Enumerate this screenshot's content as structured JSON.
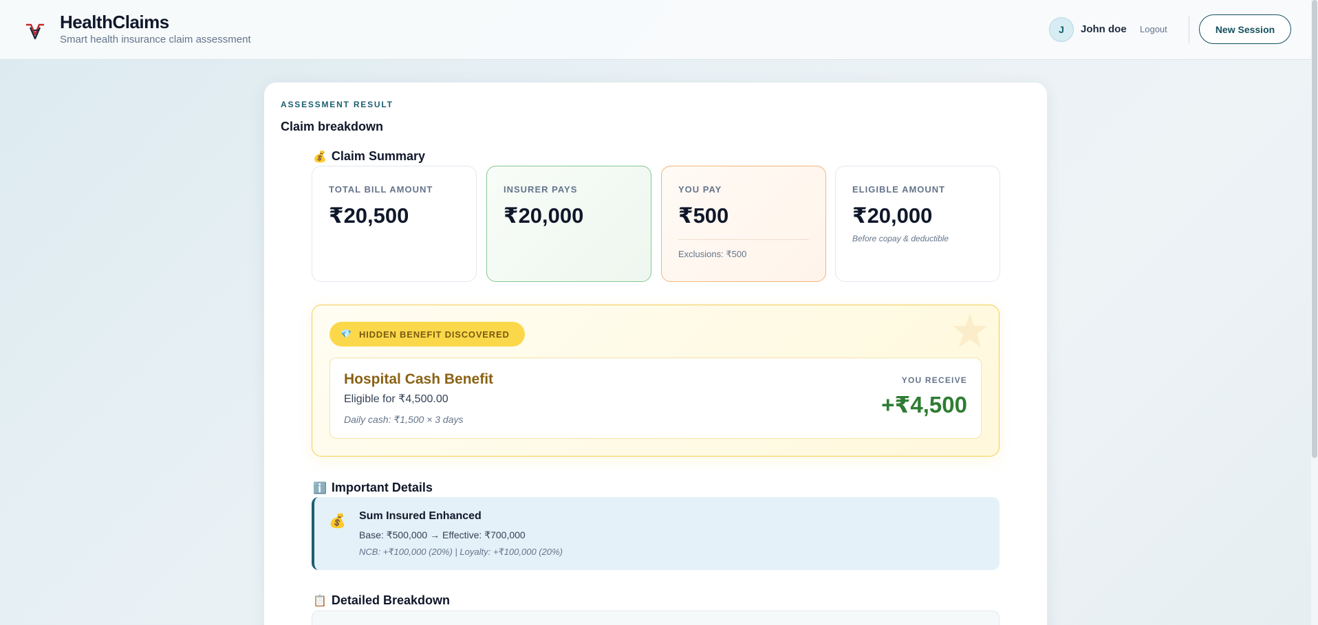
{
  "header": {
    "brand_title": "HealthClaims",
    "brand_subtitle": "Smart health insurance claim assessment",
    "user_initial": "J",
    "user_name": "John doe",
    "logout_label": "Logout",
    "new_session_label": "New Session"
  },
  "assessment": {
    "eyebrow": "ASSESSMENT RESULT",
    "title": "Claim breakdown"
  },
  "claim_summary": {
    "emoji": "💰",
    "title": "Claim Summary",
    "cards": [
      {
        "label": "TOTAL BILL AMOUNT",
        "value": "₹20,500"
      },
      {
        "label": "INSURER PAYS",
        "value": "₹20,000"
      },
      {
        "label": "YOU PAY",
        "value": "₹500",
        "note": "Exclusions: ₹500"
      },
      {
        "label": "ELIGIBLE AMOUNT",
        "value": "₹20,000",
        "note": "Before copay & deductible"
      }
    ]
  },
  "hidden_benefit": {
    "badge_emoji": "💎",
    "badge_label": "HIDDEN BENEFIT DISCOVERED",
    "name": "Hospital Cash Benefit",
    "eligible_text": "Eligible for ₹4,500.00",
    "calculation": "Daily cash: ₹1,500 × 3 days",
    "receive_label": "YOU RECEIVE",
    "receive_value": "+₹4,500"
  },
  "important_details": {
    "emoji": "ℹ️",
    "title": "Important Details",
    "item": {
      "icon_emoji": "💰",
      "title": "Sum Insured Enhanced",
      "line1": "Base: ₹500,000 → Effective: ₹700,000",
      "line2": "NCB: +₹100,000 (20%) | Loyalty: +₹100,000 (20%)"
    }
  },
  "detailed_breakdown": {
    "emoji": "📋",
    "title": "Detailed Breakdown"
  },
  "colors": {
    "accent": "#14505e",
    "insurer_green": "#86c793",
    "you_pay_orange": "#f2b47a",
    "benefit_gold": "#f2cf52",
    "receive_green": "#2f7d32"
  }
}
